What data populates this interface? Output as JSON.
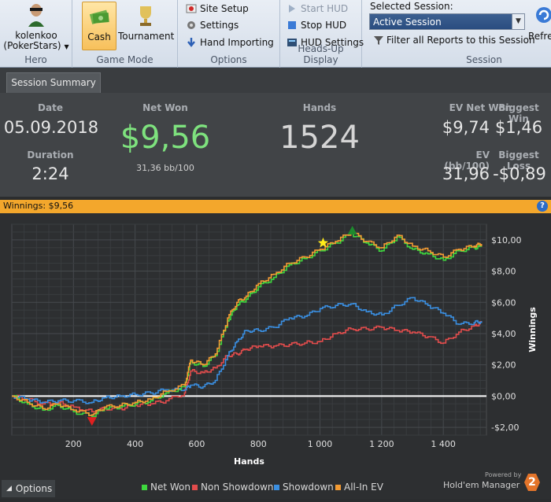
{
  "ribbon": {
    "hero": {
      "name": "kolenkoo",
      "site": "(PokerStars)",
      "group_label": "Hero"
    },
    "game_mode": {
      "cash_label": "Cash",
      "tournament_label": "Tournament",
      "group_label": "Game Mode",
      "selected": "Cash"
    },
    "options": {
      "site_setup": "Site Setup",
      "settings": "Settings",
      "hand_importing": "Hand Importing",
      "group_label": "Options"
    },
    "hud": {
      "start": "Start HUD",
      "stop": "Stop HUD",
      "settings": "HUD Settings",
      "group_label": "Heads-Up Display"
    },
    "session": {
      "selected_label": "Selected Session:",
      "selected_value": "Active Session",
      "filter": "Filter all Reports to this Session",
      "group_label": "Session"
    },
    "refresh": "Refre"
  },
  "tabs": [
    {
      "label": "Session Summary",
      "active": true
    }
  ],
  "summary": {
    "date_label": "Date",
    "date": "05.09.2018",
    "duration_label": "Duration",
    "duration": "2:24",
    "net_won_label": "Net Won",
    "net_won": "$9,56",
    "net_won_bb": "31,36 bb/100",
    "hands_label": "Hands",
    "hands": "1524",
    "ev_net_won_label": "EV Net Won",
    "ev_net_won": "$9,74",
    "biggest_win_label": "Biggest Win",
    "biggest_win": "$1,46",
    "ev_bb_label": "EV (bb/100)",
    "ev_bb": "31,96",
    "biggest_loss_label": "Biggest Loss",
    "biggest_loss": "-$0,89"
  },
  "winnings_bar": "Winnings: $9,56",
  "colors": {
    "net_won": "#3ed83e",
    "non_showdown": "#e24c4c",
    "showdown": "#3a8ee0",
    "all_in_ev": "#f39b33",
    "accent": "#f3a72c",
    "net_won_text": "#7ee27e"
  },
  "chart_data": {
    "type": "line",
    "xlabel": "Hands",
    "ylabel": "Winnings",
    "xlim": [
      0,
      1540
    ],
    "ylim": [
      -2.5,
      11
    ],
    "x_ticks": [
      "200",
      "400",
      "600",
      "800",
      "1 000",
      "1 200",
      "1 400"
    ],
    "y_ticks": [
      "-$2,00",
      "$0,00",
      "$2,00",
      "$4,00",
      "$6,00",
      "$8,00",
      "$10,00"
    ],
    "grid": true,
    "legend_placement": "bottom",
    "x": [
      0,
      50,
      100,
      150,
      200,
      260,
      300,
      350,
      400,
      450,
      500,
      560,
      580,
      620,
      660,
      700,
      730,
      760,
      800,
      850,
      900,
      950,
      1000,
      1050,
      1100,
      1150,
      1200,
      1250,
      1300,
      1350,
      1400,
      1450,
      1500,
      1524
    ],
    "series": [
      {
        "name": "Net Won",
        "values": [
          0,
          -0.5,
          -0.9,
          -0.6,
          -1,
          -1.3,
          -0.8,
          -0.7,
          -0.5,
          -0.3,
          0.2,
          0.6,
          2.2,
          1.9,
          2.6,
          4.8,
          5.8,
          6.2,
          7,
          7.6,
          8.4,
          8.8,
          9.3,
          9.8,
          10.4,
          9.8,
          9.3,
          10.2,
          9.4,
          9.1,
          8.7,
          9.3,
          9.5,
          9.56
        ]
      },
      {
        "name": "Non Showdown",
        "values": [
          0,
          -0.2,
          -0.5,
          -0.4,
          -0.7,
          -1,
          -0.8,
          -0.8,
          -0.6,
          -0.5,
          -0.3,
          0.2,
          1.6,
          1.5,
          1.8,
          2.6,
          2.7,
          3,
          3.2,
          3.2,
          3.3,
          3.4,
          3.5,
          4,
          4.3,
          4.3,
          4.4,
          4.2,
          4.1,
          3.8,
          3.4,
          4.1,
          4.5,
          4.7
        ]
      },
      {
        "name": "Showdown",
        "values": [
          0,
          -0.2,
          -0.4,
          -0.3,
          -0.3,
          -0.4,
          -0.1,
          0,
          0.1,
          0.2,
          0.4,
          0.4,
          0.7,
          0.6,
          1,
          2.6,
          3.5,
          4.2,
          4.2,
          4.4,
          5,
          5.1,
          5.6,
          5.8,
          5.9,
          5.4,
          5.2,
          5.8,
          6.3,
          5.8,
          5.3,
          4.6,
          4.7,
          4.8
        ]
      },
      {
        "name": "All-In EV",
        "values": [
          0,
          -0.4,
          -0.8,
          -0.5,
          -0.9,
          -1.2,
          -0.7,
          -0.6,
          -0.4,
          -0.2,
          0.3,
          0.7,
          2.3,
          2,
          2.7,
          5,
          6,
          6.4,
          7.2,
          7.8,
          8.5,
          8.9,
          9.4,
          9.9,
          10.5,
          9.9,
          9.5,
          10.3,
          9.6,
          9.3,
          8.9,
          9.4,
          9.6,
          9.74
        ]
      }
    ],
    "markers": [
      {
        "type": "max",
        "x": 1105,
        "y": 10.6,
        "color": "#1e8a2e"
      },
      {
        "type": "min",
        "x": 260,
        "y": -1.6,
        "color": "#e02020"
      },
      {
        "type": "star",
        "x": 1010,
        "y": 9.8,
        "color": "#ffec1a"
      }
    ]
  },
  "bottom": {
    "options_label": "Options",
    "powered_by": "Powered by",
    "brand": "Hold'em Manager",
    "brand_num": "2"
  }
}
